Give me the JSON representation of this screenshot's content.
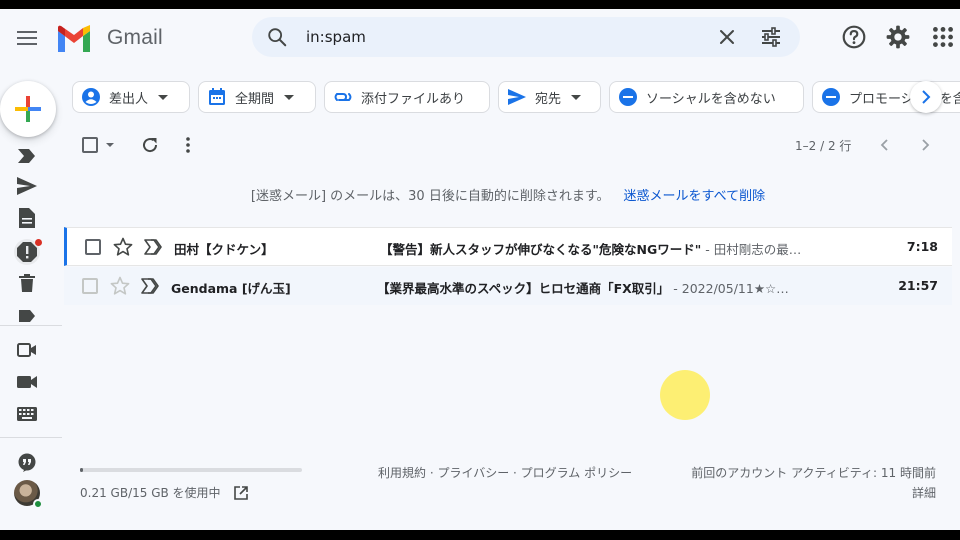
{
  "app": {
    "name": "Gmail"
  },
  "search": {
    "query": "in:spam"
  },
  "filters": [
    {
      "label": "差出人"
    },
    {
      "label": "全期間"
    },
    {
      "label": "添付ファイルあり"
    },
    {
      "label": "宛先"
    },
    {
      "label": "ソーシャルを含めない"
    },
    {
      "label": "プロモーションを含めない"
    }
  ],
  "toolbar": {
    "pagination": "1–2 / 2 行"
  },
  "banner": {
    "text": "[迷惑メール] のメールは、30 日後に自動的に削除されます。",
    "action": "迷惑メールをすべて削除"
  },
  "emails": [
    {
      "sender": "田村【クドケン】",
      "subject": "【警告】新人スタッフが伸びなくなる\"危険なNGワード\"",
      "snippet": " - 田村剛志の最…",
      "time": "7:18",
      "unread": true
    },
    {
      "sender": "Gendama [げん玉]",
      "subject": "【業界最高水準のスペック】ヒロセ通商「FX取引」",
      "snippet": " - 2022/05/11★☆…",
      "time": "21:57",
      "unread": false
    }
  ],
  "footer": {
    "storage": "0.21 GB/15 GB を使用中",
    "storage_fraction": 0.014,
    "links": "利用規約 · プライバシー · プログラム ポリシー",
    "activity": "前回のアカウント アクティビティ: 11 時間前",
    "details": "詳細"
  },
  "colors": {
    "accent_blue": "#0b57d0",
    "selection_bar": "#1a73e8",
    "background": "#f6f8fc"
  }
}
